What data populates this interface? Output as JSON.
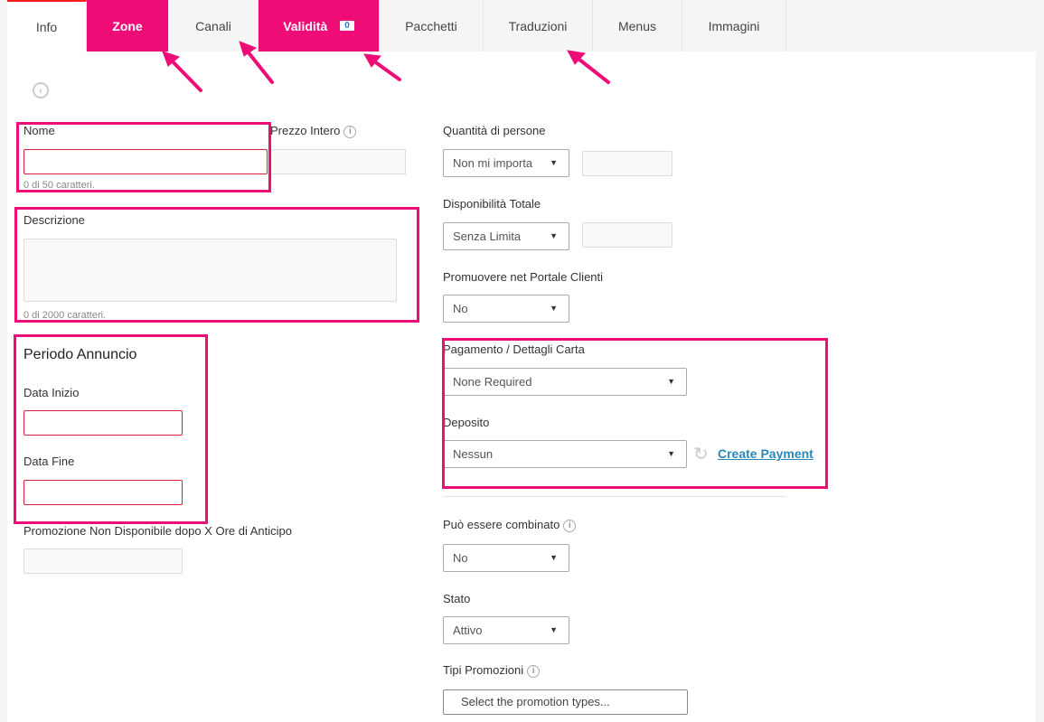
{
  "tabs": [
    {
      "label": "Info",
      "state": "active"
    },
    {
      "label": "Zone",
      "state": "highlighted"
    },
    {
      "label": "Canali",
      "state": "normal"
    },
    {
      "label": "Validità",
      "state": "highlighted",
      "badge": "0"
    },
    {
      "label": "Pacchetti",
      "state": "normal"
    },
    {
      "label": "Traduzioni",
      "state": "normal"
    },
    {
      "label": "Menus",
      "state": "normal"
    },
    {
      "label": "Immagini",
      "state": "normal"
    }
  ],
  "back_icon": "chevron-left-circle-icon",
  "left": {
    "nome_label": "Nome",
    "nome_value": "",
    "nome_hint": "0 di 50 caratteri.",
    "prezzo_label": "Prezzo Intero",
    "prezzo_value": "",
    "descrizione_label": "Descrizione",
    "descrizione_value": "",
    "descrizione_hint": "0 di 2000 caratteri.",
    "periodo_title": "Periodo Annuncio",
    "data_inizio_label": "Data Inizio",
    "data_inizio_value": "",
    "data_fine_label": "Data Fine",
    "data_fine_value": "",
    "non_disponibile_label": "Promozione Non Disponibile dopo X Ore di Anticipo",
    "non_disponibile_value": ""
  },
  "right": {
    "quantita_label": "Quantità di persone",
    "quantita_select": "Non mi importa",
    "quantita_value": "",
    "disponibilita_label": "Disponibilità Totale",
    "disponibilita_select": "Senza Limita",
    "disponibilita_value": "",
    "promuovere_label": "Promuovere net Portale Clienti",
    "promuovere_select": "No",
    "pagamento_label": "Pagamento / Dettagli Carta",
    "pagamento_select": "None Required",
    "deposito_label": "Deposito",
    "deposito_select": "Nessun",
    "create_payment": "Create Payment",
    "combinato_label": "Può essere combinato",
    "combinato_select": "No",
    "stato_label": "Stato",
    "stato_select": "Attivo",
    "tipi_label": "Tipi Promozioni",
    "tipi_placeholder": "Select the promotion types..."
  },
  "colors": {
    "accent_pink": "#ee0d77",
    "error_red": "#d6213a",
    "link_blue": "#2a87b8"
  }
}
